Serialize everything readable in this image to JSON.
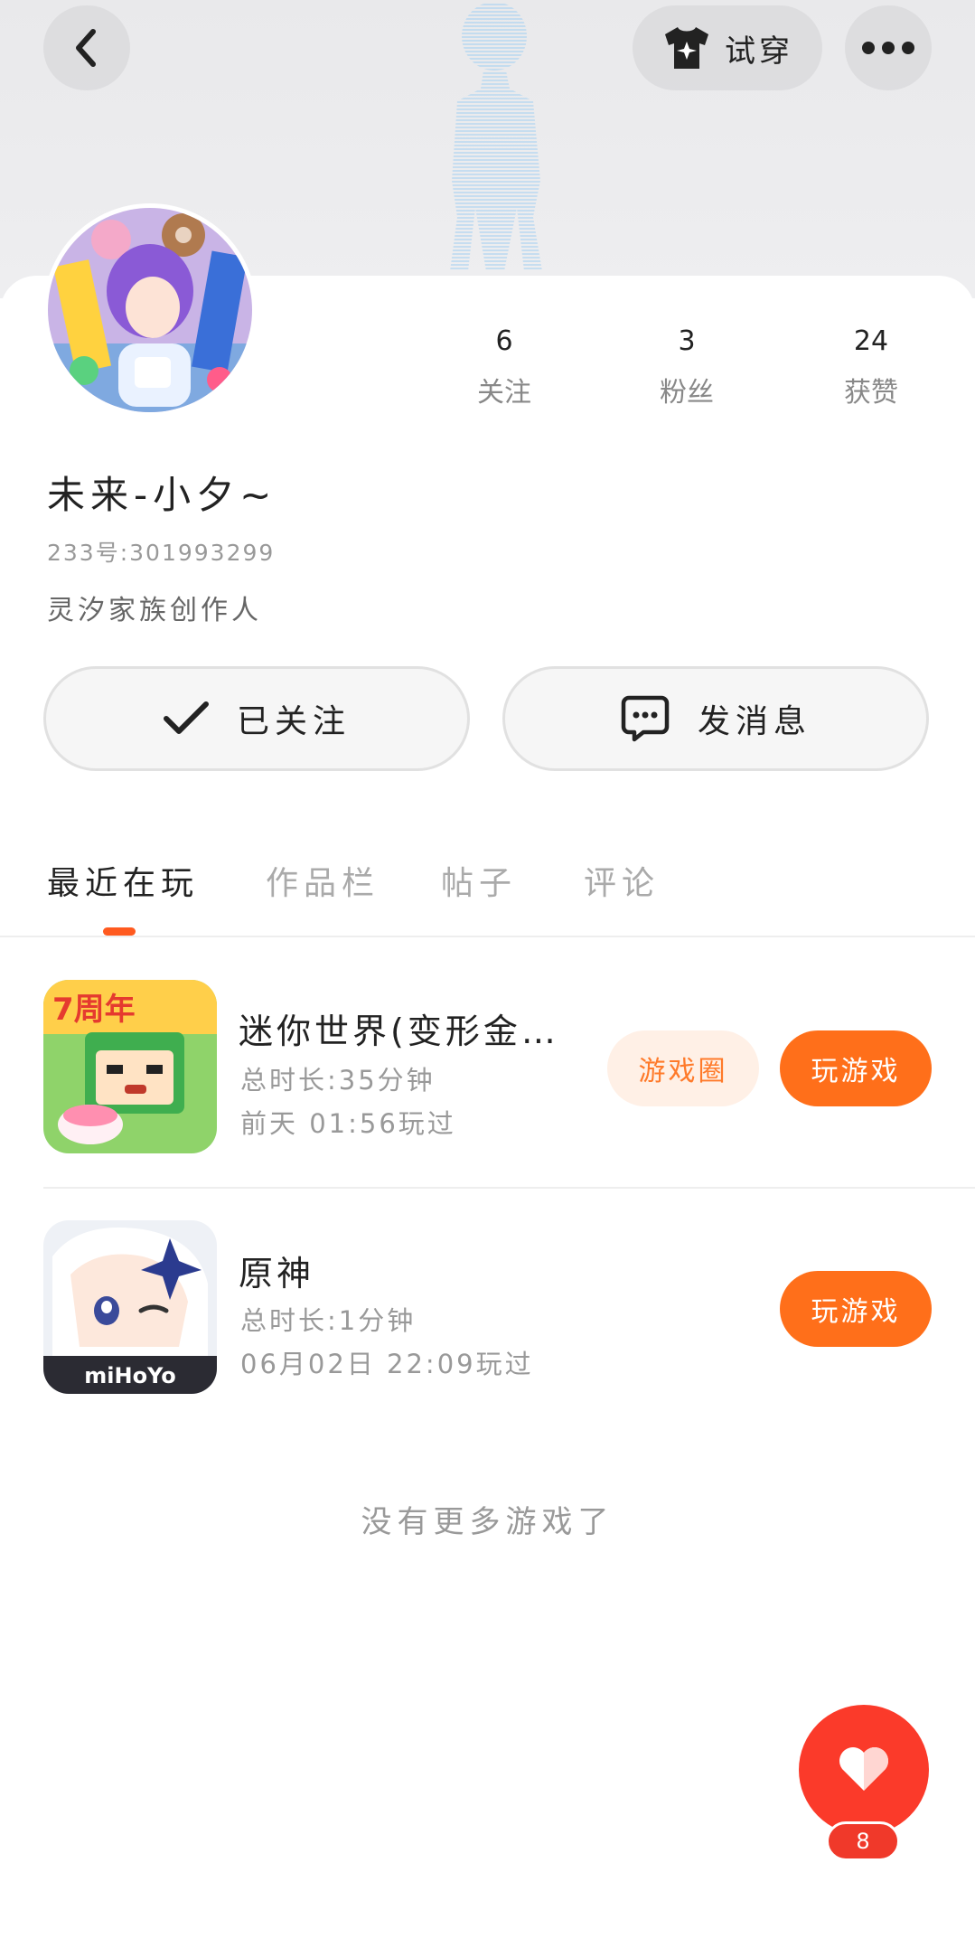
{
  "header": {
    "try_on_label": "试穿",
    "back_icon": "chevron-left-icon",
    "more_icon": "more-dots-icon",
    "tshirt_icon": "tshirt-icon"
  },
  "profile": {
    "nickname": "未来-小夕~",
    "uid": "233号:301993299",
    "bio": "灵汐家族创作人",
    "stats": [
      {
        "value": "6",
        "label": "关注"
      },
      {
        "value": "3",
        "label": "粉丝"
      },
      {
        "value": "24",
        "label": "获赞"
      }
    ]
  },
  "actions": {
    "follow_label": "已关注",
    "message_label": "发消息"
  },
  "tabs": [
    {
      "label": "最近在玩",
      "active": true
    },
    {
      "label": "作品栏",
      "active": false
    },
    {
      "label": "帖子",
      "active": false
    },
    {
      "label": "评论",
      "active": false
    }
  ],
  "games": [
    {
      "name": "迷你世界(变形金…",
      "playtime": "总时长:35分钟",
      "last_played": "前天 01:56玩过",
      "circle_label": "游戏圈",
      "play_label": "玩游戏",
      "icon_badge": "7周年"
    },
    {
      "name": "原神",
      "playtime": "总时长:1分钟",
      "last_played": "06月02日 22:09玩过",
      "play_label": "玩游戏",
      "icon_badge": "miHoYo"
    }
  ],
  "footer": {
    "no_more": "没有更多游戏了"
  },
  "like": {
    "count": "8"
  },
  "colors": {
    "accent": "#ff6f1a",
    "like": "#fb3a2a",
    "tab_indicator": "#ff5a1f"
  }
}
